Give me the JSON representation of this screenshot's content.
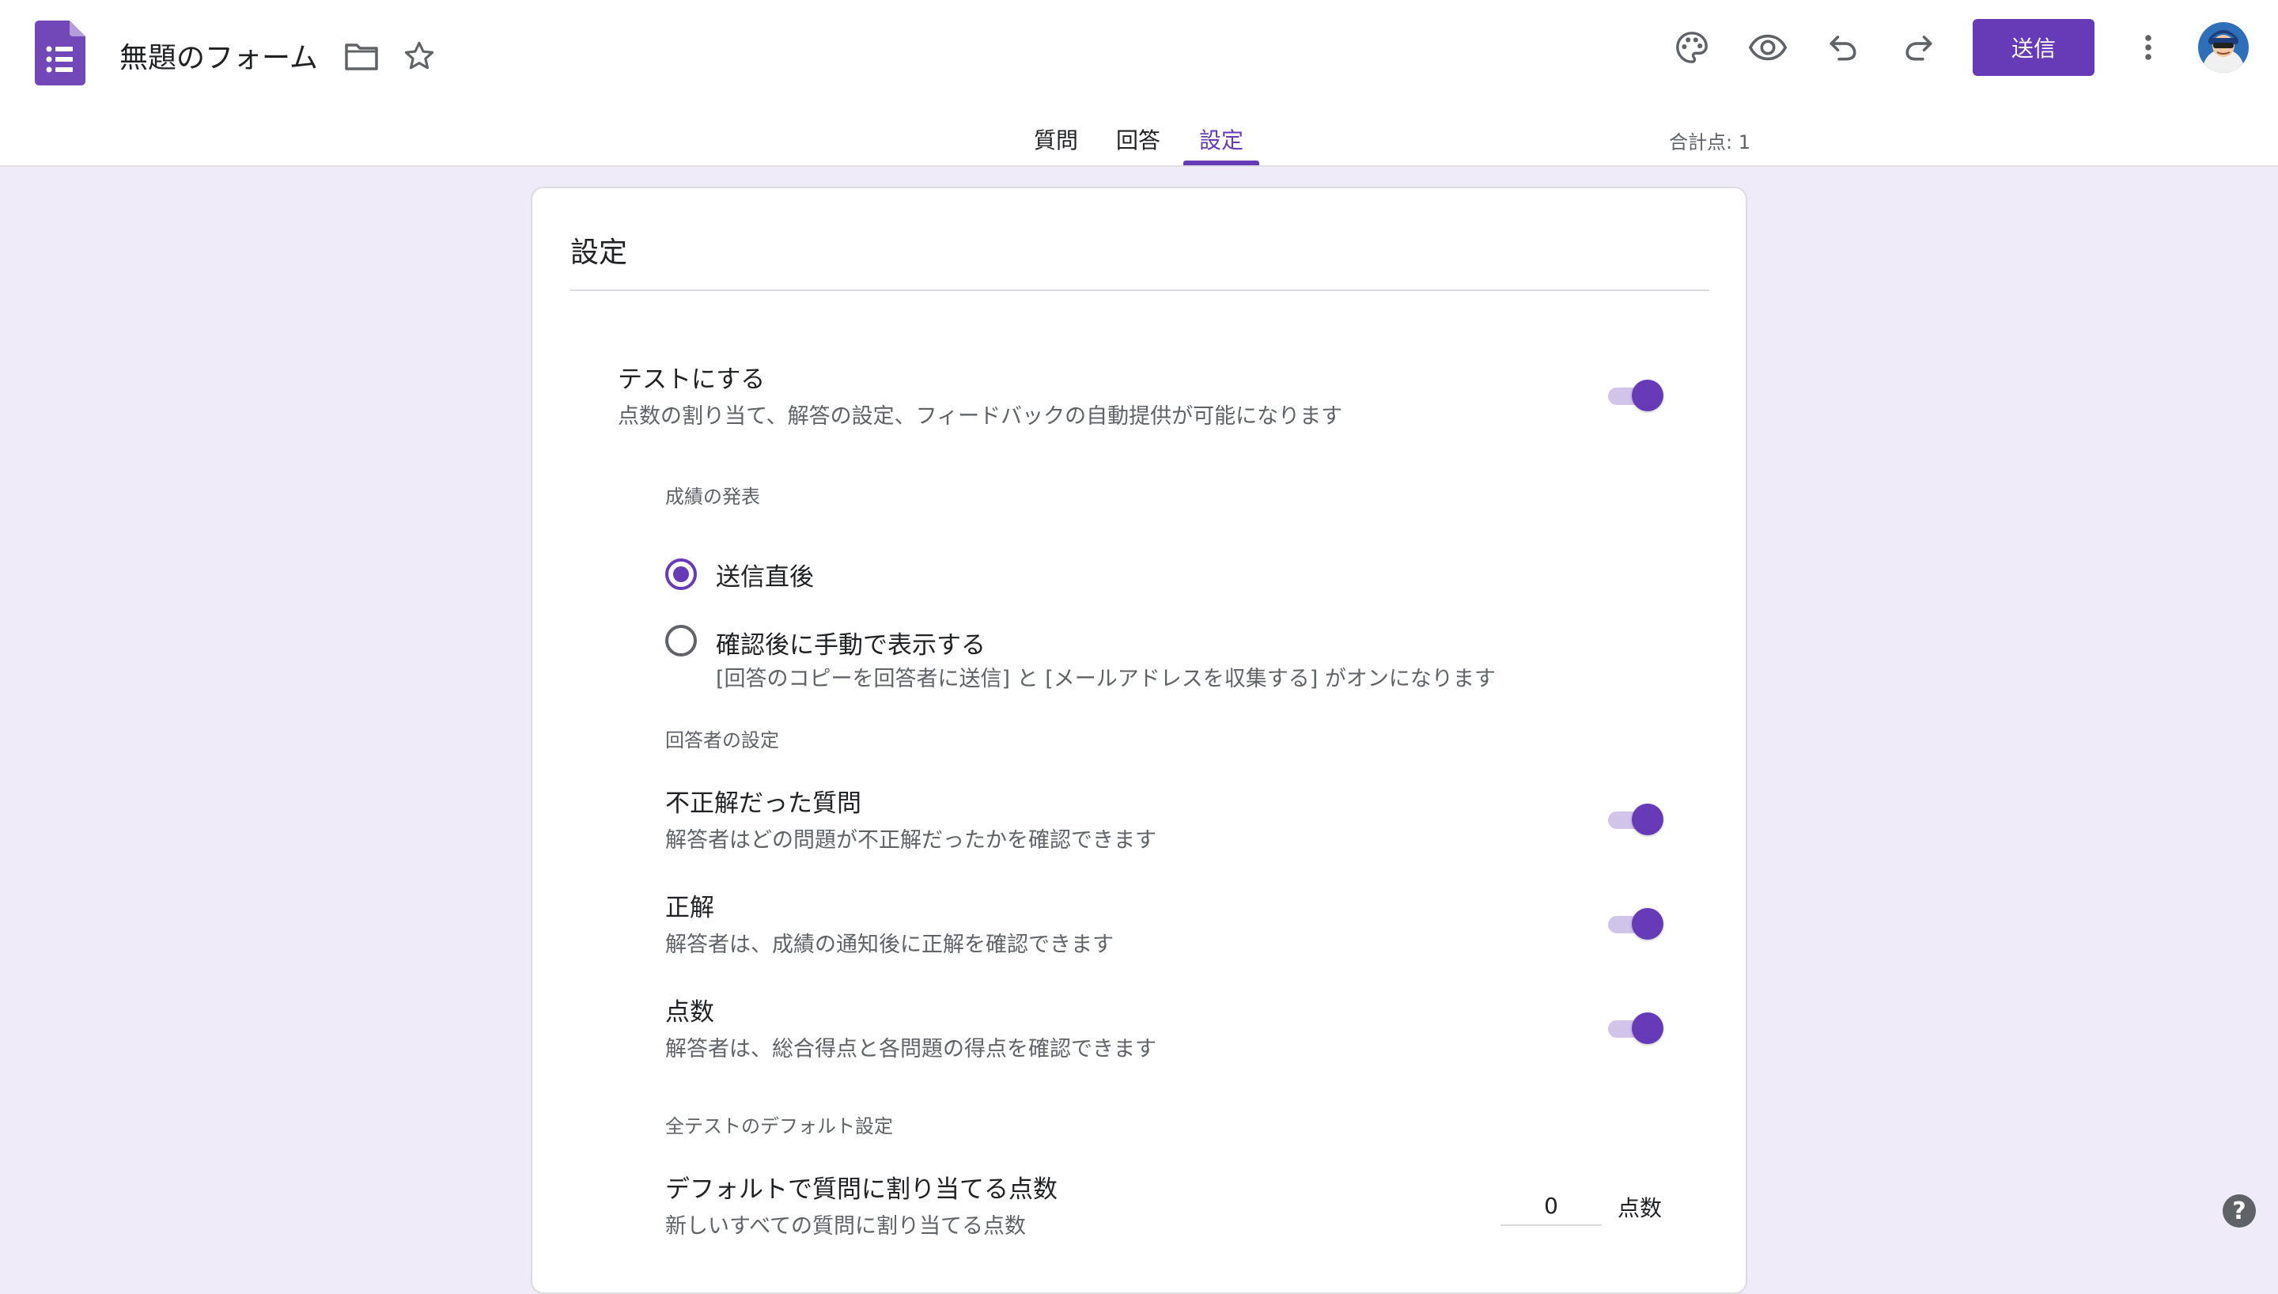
{
  "header": {
    "form_title": "無題のフォーム",
    "send_label": "送信",
    "total_points": "合計点: 1"
  },
  "tabs": [
    {
      "label": "質問",
      "active": false
    },
    {
      "label": "回答",
      "active": false
    },
    {
      "label": "設定",
      "active": true
    }
  ],
  "settings": {
    "title": "設定",
    "quiz": {
      "label": "テストにする",
      "description": "点数の割り当て、解答の設定、フィードバックの自動提供が可能になります",
      "enabled": true
    },
    "grade_release": {
      "heading": "成績の発表",
      "options": [
        {
          "label": "送信直後",
          "checked": true
        },
        {
          "label": "確認後に手動で表示する",
          "checked": false,
          "note": "[回答のコピーを回答者に送信] と [メールアドレスを収集する] がオンになります"
        }
      ]
    },
    "respondent": {
      "heading": "回答者の設定",
      "items": [
        {
          "label": "不正解だった質問",
          "description": "解答者はどの問題が不正解だったかを確認できます",
          "enabled": true
        },
        {
          "label": "正解",
          "description": "解答者は、成績の通知後に正解を確認できます",
          "enabled": true
        },
        {
          "label": "点数",
          "description": "解答者は、総合得点と各問題の得点を確認できます",
          "enabled": true
        }
      ]
    },
    "defaults": {
      "heading": "全テストのデフォルト設定",
      "label": "デフォルトで質問に割り当てる点数",
      "description": "新しいすべての質問に割り当てる点数",
      "points_value": "0",
      "points_unit": "点数"
    }
  },
  "help_label": "?",
  "colors": {
    "accent": "#673ab7",
    "background": "#f0ebf8",
    "track": "#d1c4e9"
  }
}
